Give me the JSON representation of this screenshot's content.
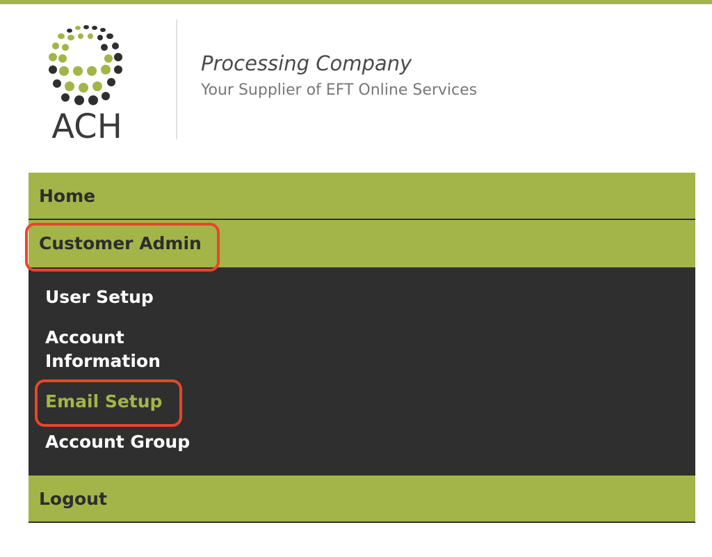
{
  "header": {
    "logo_text": "ACH",
    "company_name": "Processing Company",
    "tagline": "Your Supplier of EFT Online Services"
  },
  "nav": {
    "home": "Home",
    "customer_admin": "Customer Admin",
    "submenu": {
      "user_setup": "User Setup",
      "account_information_line1": "Account",
      "account_information_line2": "Information",
      "email_setup": "Email Setup",
      "account_group": "Account Group"
    },
    "logout": "Logout"
  },
  "colors": {
    "accent_green": "#a3b548",
    "menu_dark": "#2f2f2f",
    "highlight_red": "#e8452c"
  }
}
